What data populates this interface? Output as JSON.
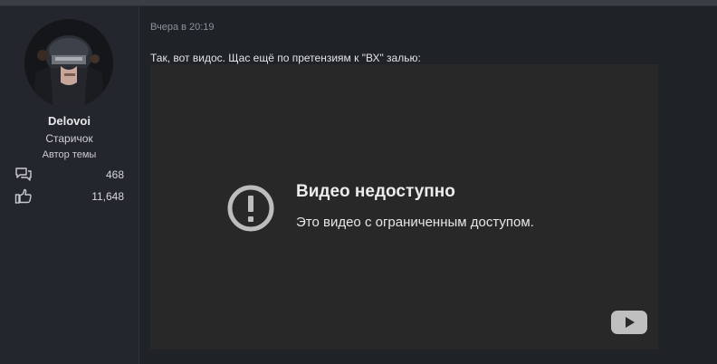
{
  "post": {
    "date": "Вчера в 20:19",
    "text": "Так, вот видос. Щас ещё по претензиям к \"ВХ\" залью:"
  },
  "user": {
    "name": "Delovoi",
    "title": "Старичок",
    "badge": "Автор темы",
    "messages_count": "468",
    "likes_count": "11,648",
    "messages_icon": "speech-bubbles-icon",
    "likes_icon": "thumbs-up-icon"
  },
  "video": {
    "title": "Видео недоступно",
    "subtitle": "Это видео с ограниченным доступом.",
    "status_icon": "exclamation-circle-icon",
    "logo_icon": "youtube-play-icon"
  }
}
